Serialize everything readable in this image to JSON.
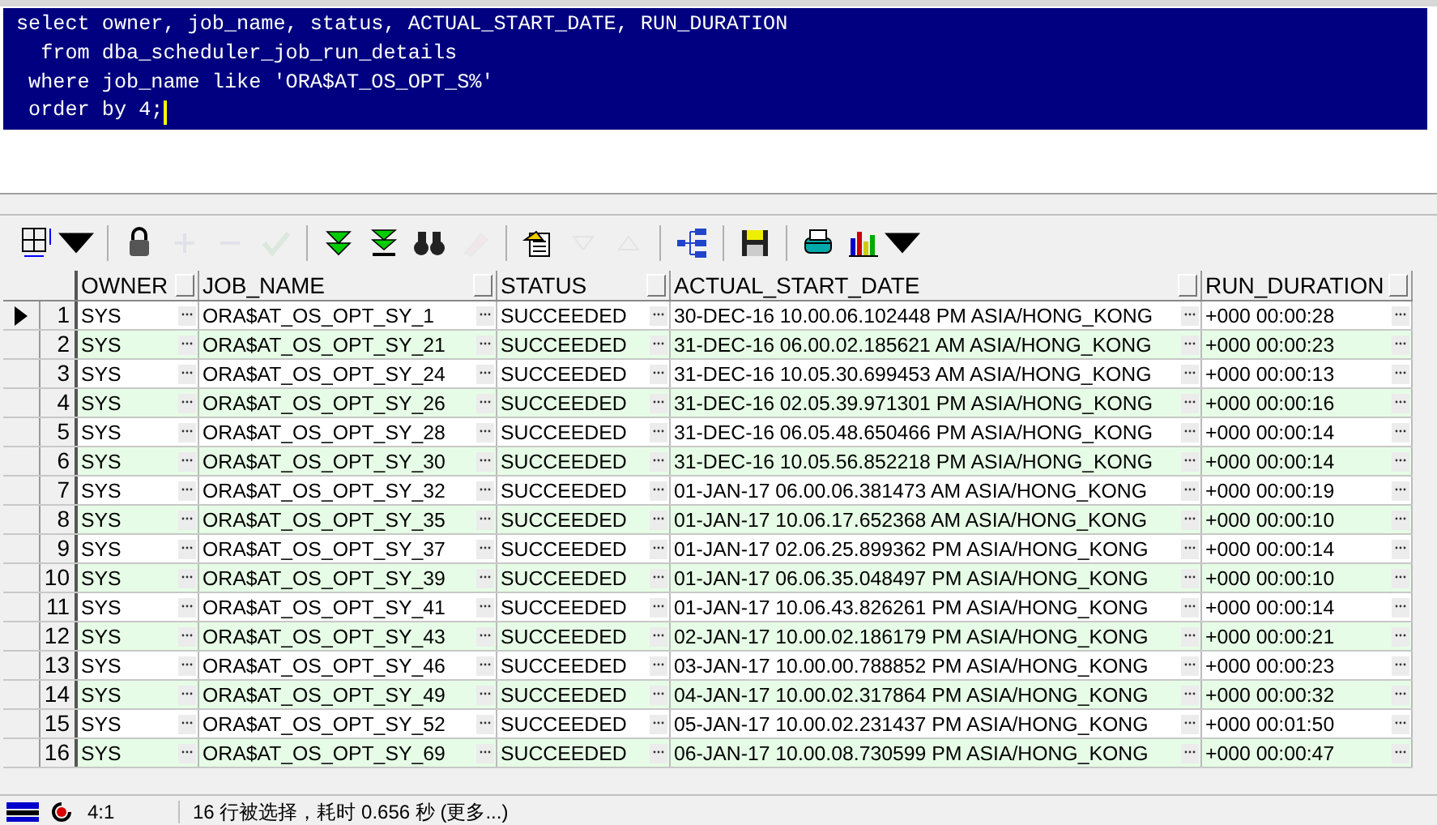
{
  "editor": {
    "lines": [
      "select owner, job_name, status, ACTUAL_START_DATE, RUN_DURATION",
      "  from dba_scheduler_job_run_details",
      " where job_name like 'ORA$AT_OS_OPT_S%'",
      " order by 4;"
    ]
  },
  "toolbar": [
    {
      "kind": "grid",
      "disabled": false
    },
    {
      "kind": "lock",
      "disabled": false
    },
    {
      "kind": "plus",
      "disabled": true
    },
    {
      "kind": "minus",
      "disabled": true
    },
    {
      "kind": "check",
      "disabled": true
    },
    {
      "kind": "fetch-next",
      "disabled": false
    },
    {
      "kind": "fetch-last",
      "disabled": false
    },
    {
      "kind": "find",
      "disabled": false
    },
    {
      "kind": "clear",
      "disabled": true
    },
    {
      "kind": "export",
      "disabled": false
    },
    {
      "kind": "down",
      "disabled": true
    },
    {
      "kind": "up",
      "disabled": true
    },
    {
      "kind": "tree",
      "disabled": false
    },
    {
      "kind": "save",
      "disabled": false
    },
    {
      "kind": "print",
      "disabled": false
    },
    {
      "kind": "chart",
      "disabled": false
    }
  ],
  "table": {
    "columns": [
      "OWNER",
      "JOB_NAME",
      "STATUS",
      "ACTUAL_START_DATE",
      "RUN_DURATION"
    ],
    "rows": [
      {
        "number": "1",
        "selected": true,
        "cells": [
          "SYS",
          "ORA$AT_OS_OPT_SY_1",
          "SUCCEEDED",
          "30-DEC-16 10.00.06.102448 PM ASIA/HONG_KONG",
          "+000 00:00:28"
        ]
      },
      {
        "number": "2",
        "selected": false,
        "cells": [
          "SYS",
          "ORA$AT_OS_OPT_SY_21",
          "SUCCEEDED",
          "31-DEC-16 06.00.02.185621 AM ASIA/HONG_KONG",
          "+000 00:00:23"
        ]
      },
      {
        "number": "3",
        "selected": false,
        "cells": [
          "SYS",
          "ORA$AT_OS_OPT_SY_24",
          "SUCCEEDED",
          "31-DEC-16 10.05.30.699453 AM ASIA/HONG_KONG",
          "+000 00:00:13"
        ]
      },
      {
        "number": "4",
        "selected": false,
        "cells": [
          "SYS",
          "ORA$AT_OS_OPT_SY_26",
          "SUCCEEDED",
          "31-DEC-16 02.05.39.971301 PM ASIA/HONG_KONG",
          "+000 00:00:16"
        ]
      },
      {
        "number": "5",
        "selected": false,
        "cells": [
          "SYS",
          "ORA$AT_OS_OPT_SY_28",
          "SUCCEEDED",
          "31-DEC-16 06.05.48.650466 PM ASIA/HONG_KONG",
          "+000 00:00:14"
        ]
      },
      {
        "number": "6",
        "selected": false,
        "cells": [
          "SYS",
          "ORA$AT_OS_OPT_SY_30",
          "SUCCEEDED",
          "31-DEC-16 10.05.56.852218 PM ASIA/HONG_KONG",
          "+000 00:00:14"
        ]
      },
      {
        "number": "7",
        "selected": false,
        "cells": [
          "SYS",
          "ORA$AT_OS_OPT_SY_32",
          "SUCCEEDED",
          "01-JAN-17 06.00.06.381473 AM ASIA/HONG_KONG",
          "+000 00:00:19"
        ]
      },
      {
        "number": "8",
        "selected": false,
        "cells": [
          "SYS",
          "ORA$AT_OS_OPT_SY_35",
          "SUCCEEDED",
          "01-JAN-17 10.06.17.652368 AM ASIA/HONG_KONG",
          "+000 00:00:10"
        ]
      },
      {
        "number": "9",
        "selected": false,
        "cells": [
          "SYS",
          "ORA$AT_OS_OPT_SY_37",
          "SUCCEEDED",
          "01-JAN-17 02.06.25.899362 PM ASIA/HONG_KONG",
          "+000 00:00:14"
        ]
      },
      {
        "number": "10",
        "selected": false,
        "cells": [
          "SYS",
          "ORA$AT_OS_OPT_SY_39",
          "SUCCEEDED",
          "01-JAN-17 06.06.35.048497 PM ASIA/HONG_KONG",
          "+000 00:00:10"
        ]
      },
      {
        "number": "11",
        "selected": false,
        "cells": [
          "SYS",
          "ORA$AT_OS_OPT_SY_41",
          "SUCCEEDED",
          "01-JAN-17 10.06.43.826261 PM ASIA/HONG_KONG",
          "+000 00:00:14"
        ]
      },
      {
        "number": "12",
        "selected": false,
        "cells": [
          "SYS",
          "ORA$AT_OS_OPT_SY_43",
          "SUCCEEDED",
          "02-JAN-17 10.00.02.186179 PM ASIA/HONG_KONG",
          "+000 00:00:21"
        ]
      },
      {
        "number": "13",
        "selected": false,
        "cells": [
          "SYS",
          "ORA$AT_OS_OPT_SY_46",
          "SUCCEEDED",
          "03-JAN-17 10.00.00.788852 PM ASIA/HONG_KONG",
          "+000 00:00:23"
        ]
      },
      {
        "number": "14",
        "selected": false,
        "cells": [
          "SYS",
          "ORA$AT_OS_OPT_SY_49",
          "SUCCEEDED",
          "04-JAN-17 10.00.02.317864 PM ASIA/HONG_KONG",
          "+000 00:00:32"
        ]
      },
      {
        "number": "15",
        "selected": false,
        "cells": [
          "SYS",
          "ORA$AT_OS_OPT_SY_52",
          "SUCCEEDED",
          "05-JAN-17 10.00.02.231437 PM ASIA/HONG_KONG",
          "+000 00:01:50"
        ]
      },
      {
        "number": "16",
        "selected": false,
        "cells": [
          "SYS",
          "ORA$AT_OS_OPT_SY_69",
          "SUCCEEDED",
          "06-JAN-17 10.00.08.730599 PM ASIA/HONG_KONG",
          "+000 00:00:47"
        ]
      }
    ]
  },
  "status_bar": {
    "position": "4:1",
    "message": "16 行被选择，耗时 0.656 秒 (更多...)"
  }
}
